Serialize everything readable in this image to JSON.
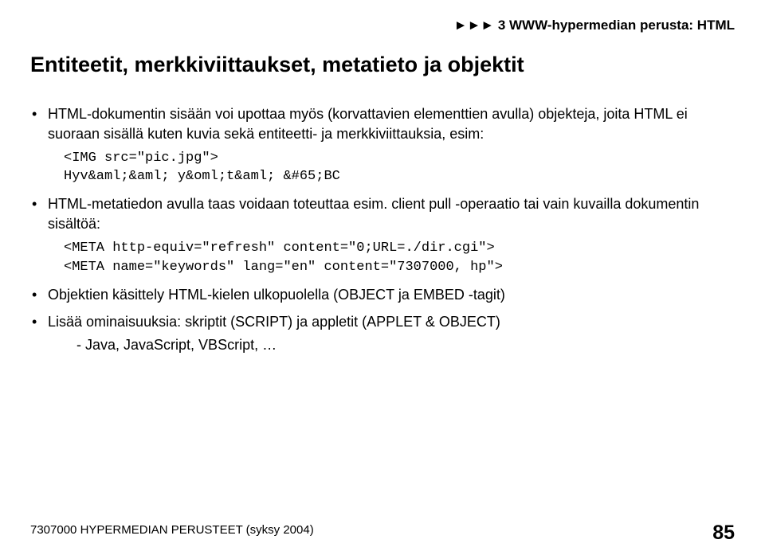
{
  "header": {
    "breadcrumb": "►►► 3 WWW-hypermedian perusta: HTML"
  },
  "title": "Entiteetit, merkkiviittaukset, metatieto ja objektit",
  "bullets": {
    "b1": "HTML-dokumentin sisään voi upottaa myös (korvattavien elementtien avulla) objekteja, joita HTML ei suoraan sisällä kuten kuvia sekä entiteetti- ja merkkiviittauksia, esim:",
    "code1_l1": "<IMG src=\"pic.jpg\">",
    "code1_l2": "Hyv&aml;&aml; y&oml;t&aml; &#65;BC",
    "b2": "HTML-metatiedon avulla  taas voidaan toteuttaa esim. client pull -operaatio tai vain kuvailla dokumentin sisältöä:",
    "code2_l1": "<META http-equiv=\"refresh\" content=\"0;URL=./dir.cgi\">",
    "code2_l2": "<META name=\"keywords\" lang=\"en\" content=\"7307000, hp\">",
    "b3": "Objektien käsittely HTML-kielen ulkopuolella (OBJECT ja EMBED -tagit)",
    "b4": "Lisää ominaisuuksia: skriptit (SCRIPT) ja appletit (APPLET & OBJECT)",
    "b4_sub": "-  Java, JavaScript, VBScript, …"
  },
  "footer": {
    "text": "7307000 HYPERMEDIAN PERUSTEET (syksy 2004)",
    "page": "85"
  }
}
